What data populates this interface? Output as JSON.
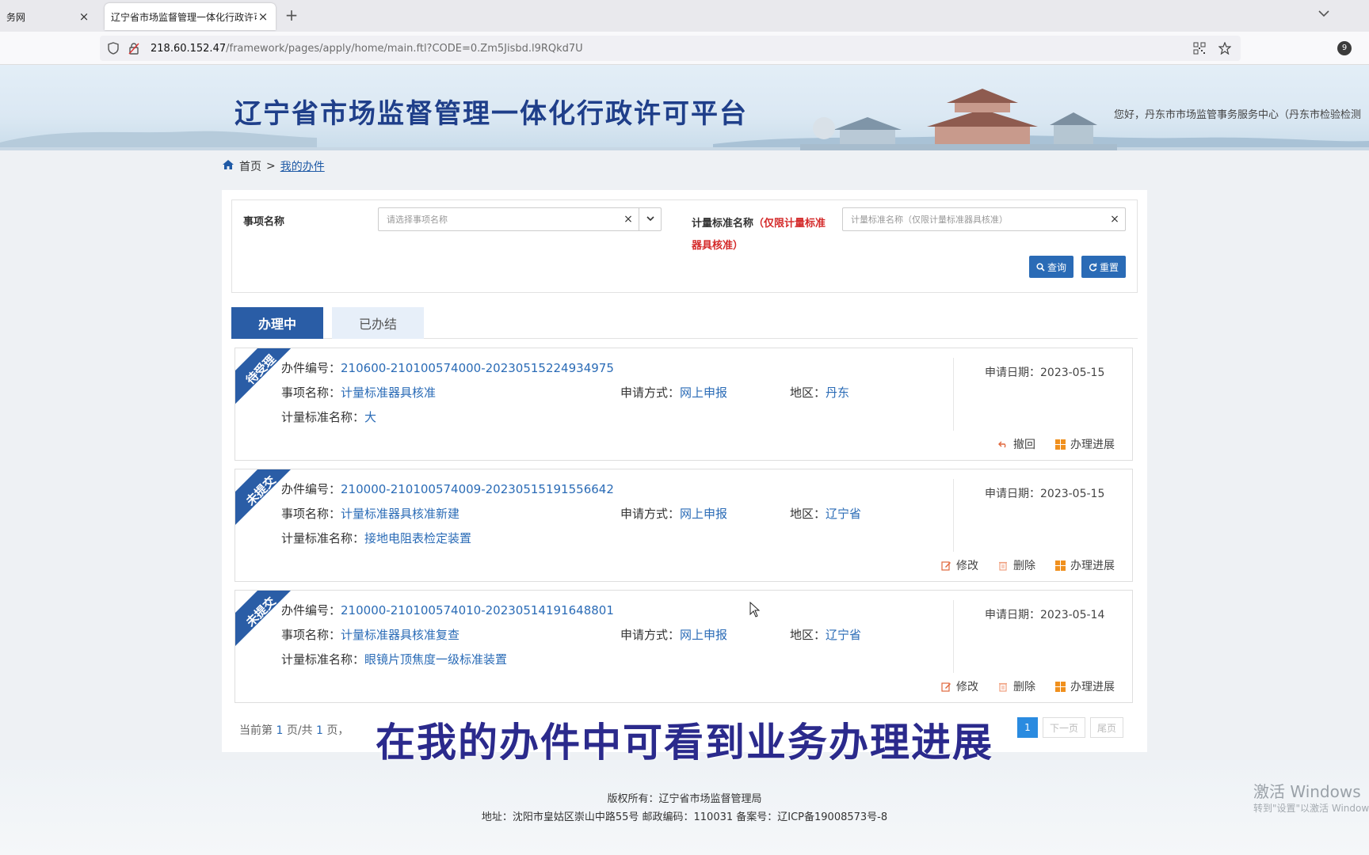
{
  "browser": {
    "tabs": [
      {
        "title": "务网",
        "active": false
      },
      {
        "title": "辽宁省市场监督管理一体化行政许可",
        "active": true
      }
    ],
    "url_host": "218.60.152.47",
    "url_path": "/framework/pages/apply/home/main.ftl?CODE=0.Zm5Jisbd.l9RQkd7U",
    "extension_badge": "9"
  },
  "header": {
    "title": "辽宁省市场监督管理一体化行政许可平台",
    "welcome": "您好，丹东市市场监管事务服务中心（丹东市检验检测"
  },
  "breadcrumb": {
    "home": "首页",
    "separator": ">",
    "current": "我的办件"
  },
  "search": {
    "item_label": "事项名称",
    "item_placeholder": "请选择事项名称",
    "std_label": "计量标准名称",
    "std_label_note": "（仅限计量标准器具核准）",
    "std_placeholder": "计量标准名称（仅限计量标准器具核准）",
    "query_btn": "查询",
    "reset_btn": "重置"
  },
  "tabs": {
    "active": "办理中",
    "inactive": "已办结"
  },
  "labels": {
    "case_no": "办件编号：",
    "item_name": "事项名称：",
    "apply_method": "申请方式：",
    "region": "地区：",
    "std_name": "计量标准名称：",
    "apply_date": "申请日期："
  },
  "cards": [
    {
      "status": "待受理",
      "case_no": "210600-210100574000-20230515224934975",
      "item_name": "计量标准器具核准",
      "apply_method": "网上申报",
      "region": "丹东",
      "std_name": "大",
      "apply_date": "2023-05-15",
      "actions": [
        "撤回",
        "办理进展"
      ]
    },
    {
      "status": "未提交",
      "case_no": "210000-210100574009-20230515191556642",
      "item_name": "计量标准器具核准新建",
      "apply_method": "网上申报",
      "region": "辽宁省",
      "std_name": "接地电阻表检定装置",
      "apply_date": "2023-05-15",
      "actions": [
        "修改",
        "删除",
        "办理进展"
      ]
    },
    {
      "status": "未提交",
      "case_no": "210000-210100574010-20230514191648801",
      "item_name": "计量标准器具核准复查",
      "apply_method": "网上申报",
      "region": "辽宁省",
      "std_name": "眼镜片顶焦度一级标准装置",
      "apply_date": "2023-05-14",
      "actions": [
        "修改",
        "删除",
        "办理进展"
      ]
    }
  ],
  "pager": {
    "prefix": "当前第",
    "current": "1",
    "mid": "页/共",
    "total": "1",
    "suffix": "页，",
    "page_btn": "1",
    "next": "下一页",
    "last": "尾页"
  },
  "subtitle": "在我的办件中可看到业务办理进展",
  "footer": {
    "copyright": "版权所有：辽宁省市场监督管理局",
    "address": "地址：沈阳市皇姑区崇山中路55号 邮政编码：110031 备案号：辽ICP备19008573号-8"
  },
  "watermark": {
    "line1": "激活 Windows",
    "line2": "转到\"设置\"以激活 Windows。"
  },
  "colors": {
    "primary": "#2a6bb6",
    "tab_active": "#2a5da6",
    "status_ribbon": "#2a5da6",
    "title": "#1f3f8a",
    "note_red": "#d42a2a",
    "subtitle": "#2b2a8c"
  }
}
